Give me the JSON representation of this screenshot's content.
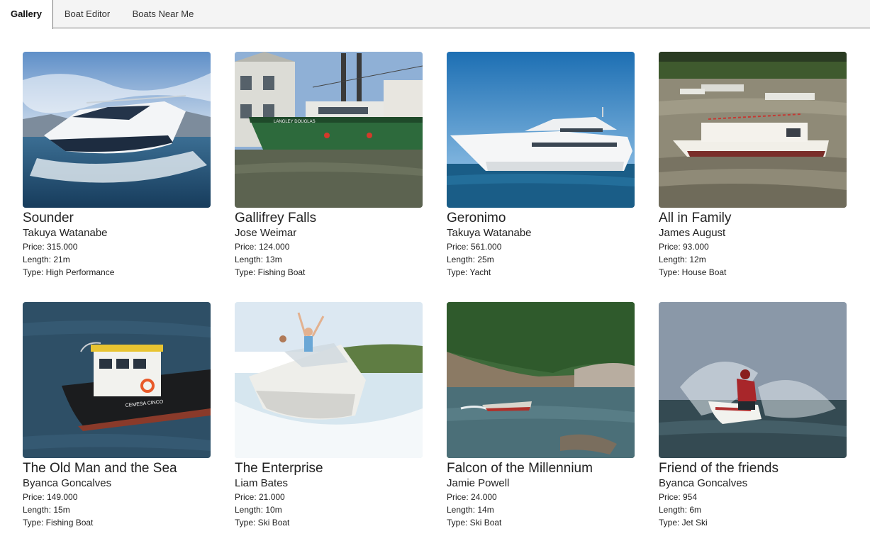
{
  "tabs": [
    {
      "label": "Gallery",
      "active": true
    },
    {
      "label": "Boat Editor",
      "active": false
    },
    {
      "label": "Boats Near Me",
      "active": false
    }
  ],
  "boats": [
    {
      "name": "Sounder",
      "owner": "Takuya Watanabe",
      "price": "Price: 315.000",
      "length": "Length: 21m",
      "type": "Type: High Performance"
    },
    {
      "name": "Gallifrey Falls",
      "owner": "Jose Weimar",
      "price": "Price: 124.000",
      "length": "Length: 13m",
      "type": "Type: Fishing Boat"
    },
    {
      "name": "Geronimo",
      "owner": "Takuya Watanabe",
      "price": "Price: 561.000",
      "length": "Length: 25m",
      "type": "Type: Yacht"
    },
    {
      "name": "All in Family",
      "owner": "James August",
      "price": "Price: 93.000",
      "length": "Length: 12m",
      "type": "Type: House Boat"
    },
    {
      "name": "The Old Man and the Sea",
      "owner": "Byanca Goncalves",
      "price": "Price: 149.000",
      "length": "Length: 15m",
      "type": "Type: Fishing Boat"
    },
    {
      "name": "The Enterprise",
      "owner": "Liam Bates",
      "price": "Price: 21.000",
      "length": "Length: 10m",
      "type": "Type: Ski Boat"
    },
    {
      "name": "Falcon of the Millennium",
      "owner": "Jamie Powell",
      "price": "Price: 24.000",
      "length": "Length: 14m",
      "type": "Type: Ski Boat"
    },
    {
      "name": "Friend of the friends",
      "owner": "Byanca Goncalves",
      "price": "Price: 954",
      "length": "Length: 6m",
      "type": "Type: Jet Ski"
    }
  ],
  "photo_labels": {
    "hull_1": "LANGLEY DOUGLAS",
    "hull_5": "CEMESA CINCO"
  }
}
